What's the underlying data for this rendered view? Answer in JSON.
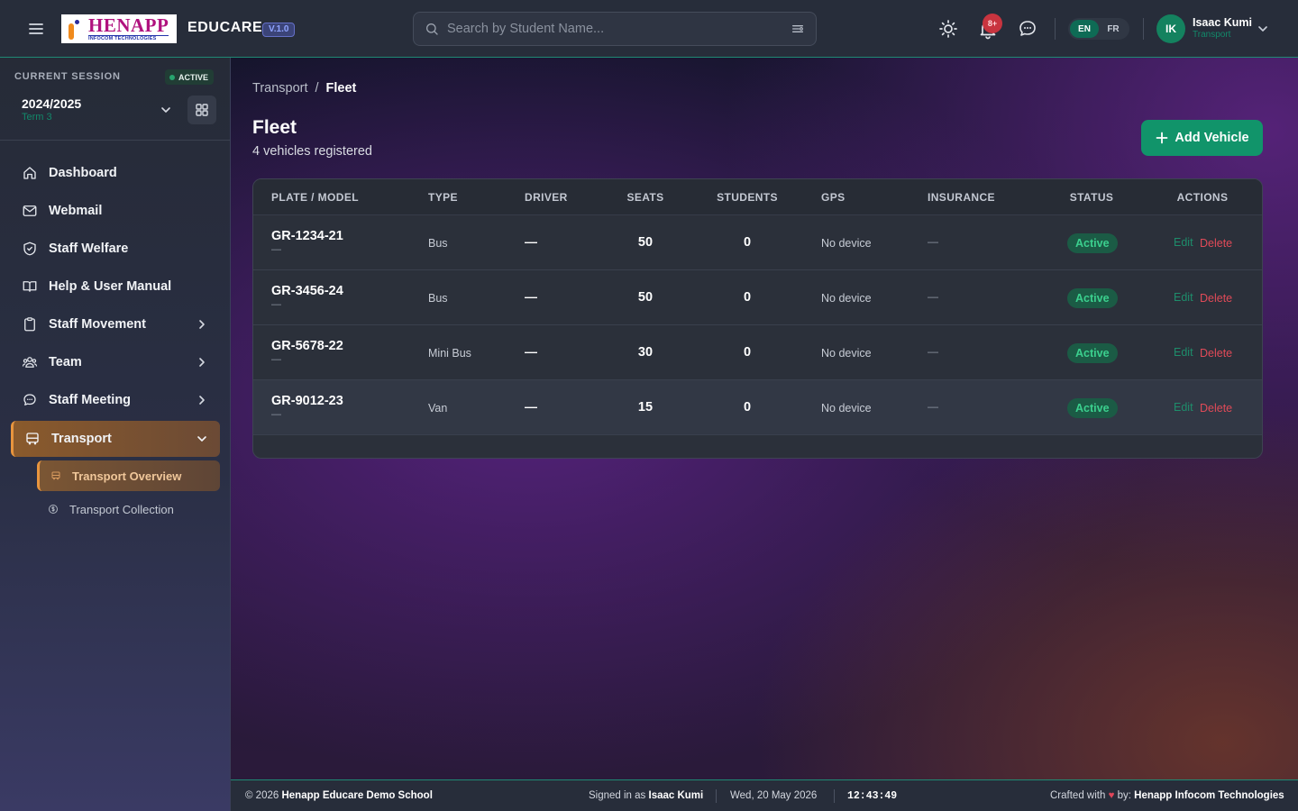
{
  "header": {
    "logo_text": "HENAPP",
    "logo_subtext": "INFOCOM TECHNOLOGIES",
    "brand": "EDUCARE",
    "version": "V.1.0",
    "search_placeholder": "Search by Student Name...",
    "notification_count": "8+",
    "languages": [
      "EN",
      "FR"
    ],
    "active_language": "EN",
    "user": {
      "initials": "IK",
      "name": "Isaac Kumi",
      "role": "Transport"
    }
  },
  "session": {
    "label": "CURRENT SESSION",
    "status": "ACTIVE",
    "year": "2024/2025",
    "term": "Term 3"
  },
  "sidebar": {
    "items": [
      {
        "label": "Dashboard",
        "icon": "home-icon"
      },
      {
        "label": "Webmail",
        "icon": "mail-icon"
      },
      {
        "label": "Staff Welfare",
        "icon": "shield-heart-icon"
      },
      {
        "label": "Help & User Manual",
        "icon": "book-open-icon"
      },
      {
        "label": "Staff Movement",
        "icon": "clipboard-icon",
        "has_submenu": true
      },
      {
        "label": "Team",
        "icon": "users-icon",
        "has_submenu": true
      },
      {
        "label": "Staff Meeting",
        "icon": "chat-bubble-icon",
        "has_submenu": true
      },
      {
        "label": "Transport",
        "icon": "bus-icon",
        "has_submenu": true,
        "expanded": true
      }
    ],
    "subitems": [
      {
        "label": "Transport Overview",
        "icon": "bus-small-icon",
        "active": true
      },
      {
        "label": "Transport Collection",
        "icon": "dollar-circle-icon"
      }
    ]
  },
  "main": {
    "breadcrumb": [
      "Transport",
      "/",
      "Fleet"
    ],
    "title": "Fleet",
    "subtitle": "4 vehicles registered",
    "add_button": "Add Vehicle",
    "table": {
      "columns": [
        "PLATE / MODEL",
        "TYPE",
        "DRIVER",
        "SEATS",
        "STUDENTS",
        "GPS",
        "INSURANCE",
        "STATUS",
        "ACTIONS"
      ],
      "rows": [
        {
          "plate": "GR-1234-21",
          "model": "—",
          "type": "Bus",
          "driver": "—",
          "seats": "50",
          "students": "0",
          "gps": "No device",
          "insurance": "—",
          "status": "Active",
          "edit": "Edit",
          "delete": "Delete"
        },
        {
          "plate": "GR-3456-24",
          "model": "—",
          "type": "Bus",
          "driver": "—",
          "seats": "50",
          "students": "0",
          "gps": "No device",
          "insurance": "—",
          "status": "Active",
          "edit": "Edit",
          "delete": "Delete"
        },
        {
          "plate": "GR-5678-22",
          "model": "—",
          "type": "Mini Bus",
          "driver": "—",
          "seats": "30",
          "students": "0",
          "gps": "No device",
          "insurance": "—",
          "status": "Active",
          "edit": "Edit",
          "delete": "Delete"
        },
        {
          "plate": "GR-9012-23",
          "model": "—",
          "type": "Van",
          "driver": "—",
          "seats": "15",
          "students": "0",
          "gps": "No device",
          "insurance": "—",
          "status": "Active",
          "edit": "Edit",
          "delete": "Delete"
        }
      ]
    }
  },
  "footer": {
    "copyright_prefix": "© 2026",
    "school": "Henapp Educare Demo School",
    "signed_in_prefix": "Signed in as",
    "signed_in_user": "Isaac Kumi",
    "date": "Wed, 20 May 2026",
    "time": "12:43:49",
    "crafted_prefix": "Crafted with",
    "crafted_by_prefix": "by:",
    "crafted_by": "Henapp Infocom Technologies"
  },
  "colors": {
    "accent_green": "#11946a",
    "active_orange": "#e8953e",
    "danger_red": "#e04a58",
    "topbar_bg": "#272d3a"
  }
}
